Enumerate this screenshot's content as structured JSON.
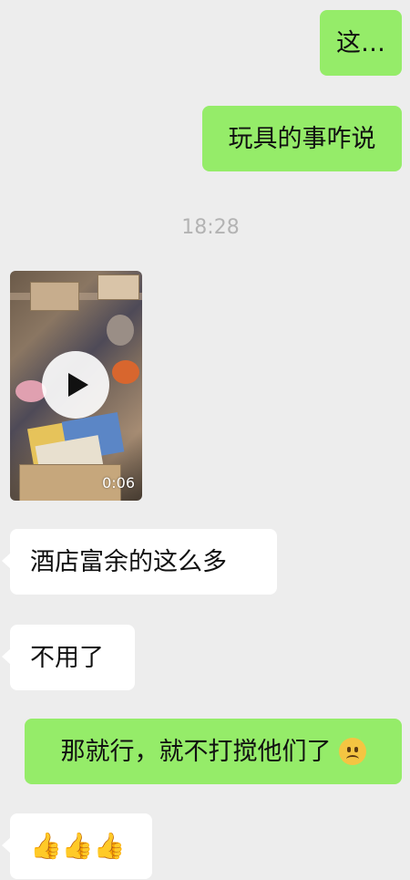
{
  "colors": {
    "background": "#ededed",
    "outgoing_bubble": "#95ec69",
    "incoming_bubble": "#ffffff",
    "timestamp": "#b3b3b3"
  },
  "messages": {
    "m1": {
      "text": "这…"
    },
    "m2": {
      "text": "玩具的事咋说"
    },
    "timestamp": "18:28",
    "video": {
      "duration": "0:06"
    },
    "m3": {
      "text": "酒店富余的这么多"
    },
    "m4": {
      "text": "不用了"
    },
    "m5": {
      "text": "那就行，就不打搅他们了",
      "emoji": "frowning-face-icon"
    },
    "m6": {
      "emoji": "thumbs-up-icon",
      "text": "👍👍👍"
    }
  }
}
